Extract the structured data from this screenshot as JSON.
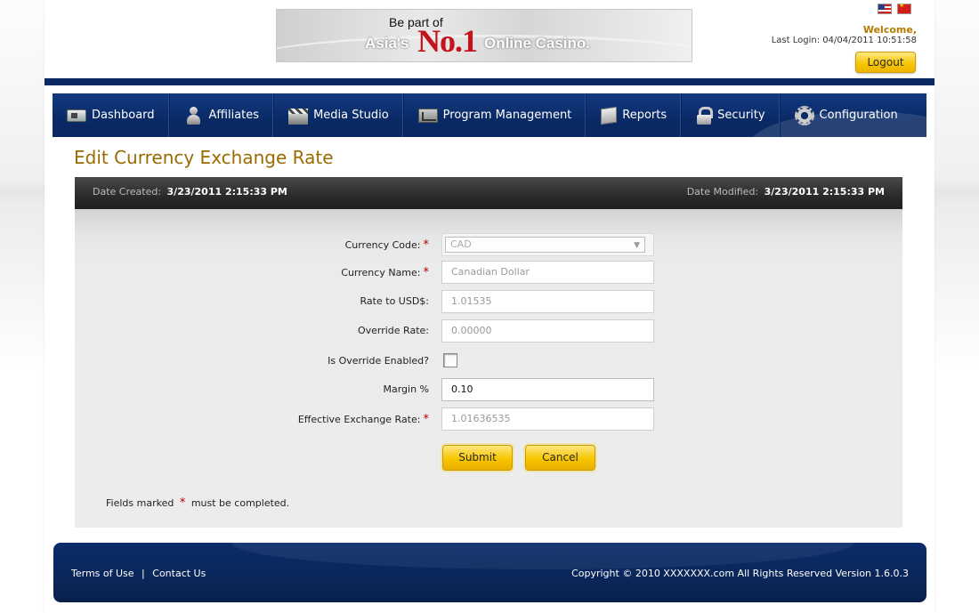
{
  "header": {
    "banner": {
      "line1": "Be part of",
      "asia": "Asia's",
      "no1": "No.1",
      "online_casino": "Online Casino."
    },
    "flags": [
      "us-flag-icon",
      "china-flag-icon"
    ],
    "welcome": "Welcome,",
    "last_login": "Last Login: 04/04/2011 10:51:58",
    "logout_label": "Logout"
  },
  "nav": {
    "items": [
      {
        "label": "Dashboard",
        "icon": "dashboard-icon"
      },
      {
        "label": "Affiliates",
        "icon": "user-icon"
      },
      {
        "label": "Media Studio",
        "icon": "clapperboard-icon"
      },
      {
        "label": "Program Management",
        "icon": "chart-icon"
      },
      {
        "label": "Reports",
        "icon": "report-icon"
      },
      {
        "label": "Security",
        "icon": "lock-icon"
      },
      {
        "label": "Configuration",
        "icon": "gear-icon"
      }
    ]
  },
  "page": {
    "title": "Edit Currency Exchange Rate"
  },
  "dates": {
    "created_label": "Date Created:",
    "created_value": "3/23/2011 2:15:33 PM",
    "modified_label": "Date Modified:",
    "modified_value": "3/23/2011 2:15:33 PM"
  },
  "form": {
    "currency_code": {
      "label": "Currency Code:",
      "value": "CAD",
      "required": "*"
    },
    "currency_name": {
      "label": "Currency Name:",
      "value": "Canadian Dollar",
      "required": "*"
    },
    "rate_to_usd": {
      "label": "Rate to USD$:",
      "value": "1.01535"
    },
    "override_rate": {
      "label": "Override Rate:",
      "value": "0.00000"
    },
    "override_enabled": {
      "label": "Is Override Enabled?",
      "checked": false
    },
    "margin": {
      "label": "Margin %",
      "value": "0.10"
    },
    "effective_rate": {
      "label": "Effective Exchange Rate:",
      "value": "1.01636535",
      "required": "*"
    },
    "submit_label": "Submit",
    "cancel_label": "Cancel",
    "note_prefix": "Fields marked",
    "note_star": "*",
    "note_suffix": "must be completed."
  },
  "footer": {
    "terms": "Terms of Use",
    "separator": "|",
    "contact": "Contact Us",
    "copyright": "Copyright © 2010 XXXXXXX.com All Rights Reserved  Version 1.6.0.3"
  },
  "colors": {
    "navy": "#0b2a63",
    "gold_button": "#f6c400",
    "title_gold": "#9b6b00",
    "required_red": "#b30000"
  }
}
